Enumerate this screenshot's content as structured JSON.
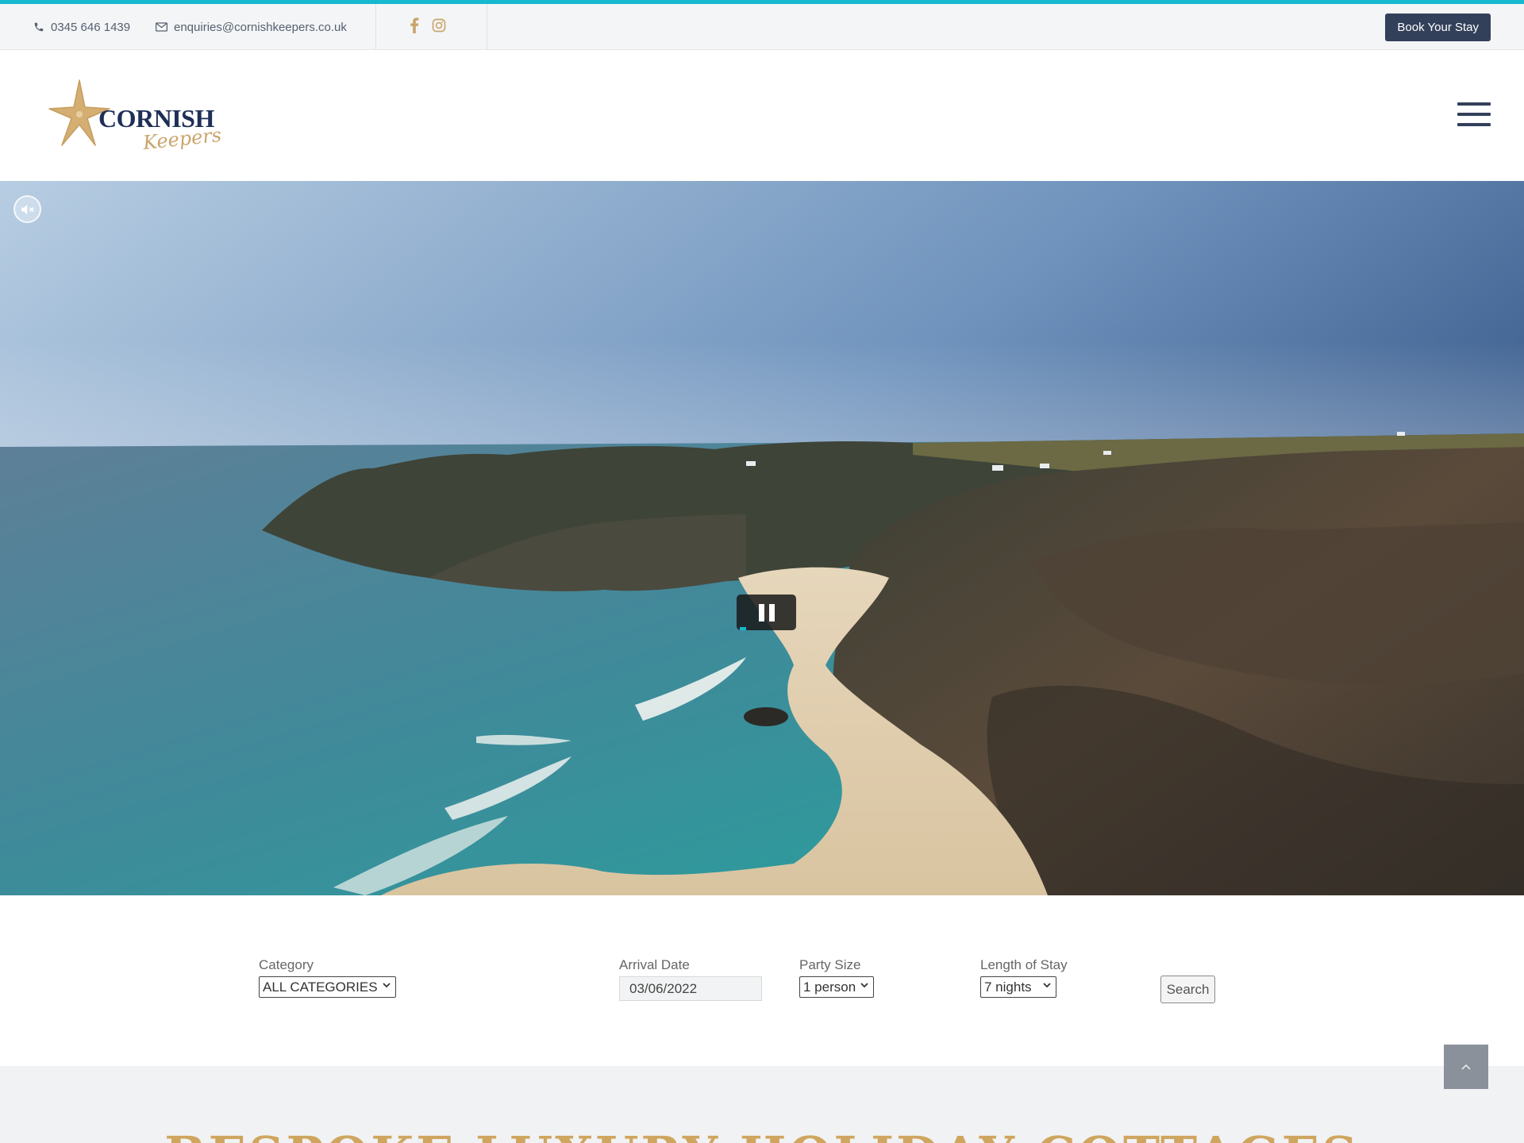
{
  "topbar": {
    "phone": "0345 646 1439",
    "email": "enquiries@cornishkeepers.co.uk",
    "book_label": "Book Your Stay"
  },
  "brand": {
    "name": "CORNISH",
    "script": "Keepers",
    "primary_color": "#1e2f57",
    "gold_color": "#c9a56b",
    "accent_color": "#14b8cf"
  },
  "icons": {
    "phone": "phone-icon",
    "email": "envelope-icon",
    "facebook": "facebook-icon",
    "instagram": "instagram-icon",
    "menu": "hamburger-menu-icon",
    "mute": "muted-speaker-icon",
    "pause": "pause-icon",
    "scroll_top": "chevron-up-icon"
  },
  "search": {
    "category_label": "Category",
    "category_value": "ALL CATEGORIES",
    "arrival_label": "Arrival Date",
    "arrival_value": "03/06/2022",
    "party_label": "Party Size",
    "party_value": "1 person",
    "length_label": "Length of Stay",
    "length_value": "7 nights",
    "search_label": "Search"
  },
  "section": {
    "heading": "BESPOKE LUXURY HOLIDAY COTTAGES"
  }
}
